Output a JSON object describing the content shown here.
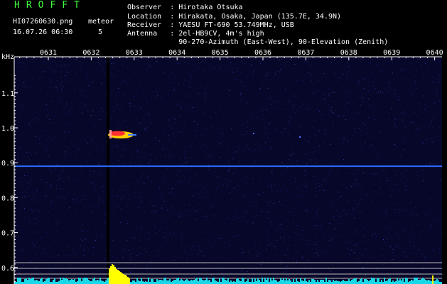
{
  "header": {
    "logo": "HROFFT",
    "filename": "HI07260630.png",
    "datetime": "16.07.26 06:30",
    "meteor_label": "meteor",
    "meteor_count": "5",
    "observer": "Observer  : Hirotaka Otsuka",
    "location": "Location  : Hirakata, Osaka, Japan (135.7E, 34.9N)",
    "receiver": "Receiver  : YAESU FT-690 53.749MHz, USB",
    "antenna": "Antenna   : 2el-HB9CV, 4m's high",
    "antenna2": "            90-270-Azimuth (East-West), 90-Elevation (Zenith)"
  },
  "axis": {
    "unit": "kHz",
    "times": [
      "0631",
      "0632",
      "0633",
      "0634",
      "0635",
      "0636",
      "0637",
      "0638",
      "0639",
      "0640"
    ],
    "freqs": [
      "1.1",
      "1.0",
      "0.9",
      "0.8",
      "0.7",
      "0.6"
    ]
  },
  "colors": {
    "background": "#000000",
    "noise": "#1c1c6a",
    "carrier": "#2a6cff",
    "green_text": "#3cff3c",
    "meteor_echo": "#ff3030",
    "bar_cyan": "#18d8e8",
    "bar_yellow": "#ffff00"
  }
}
